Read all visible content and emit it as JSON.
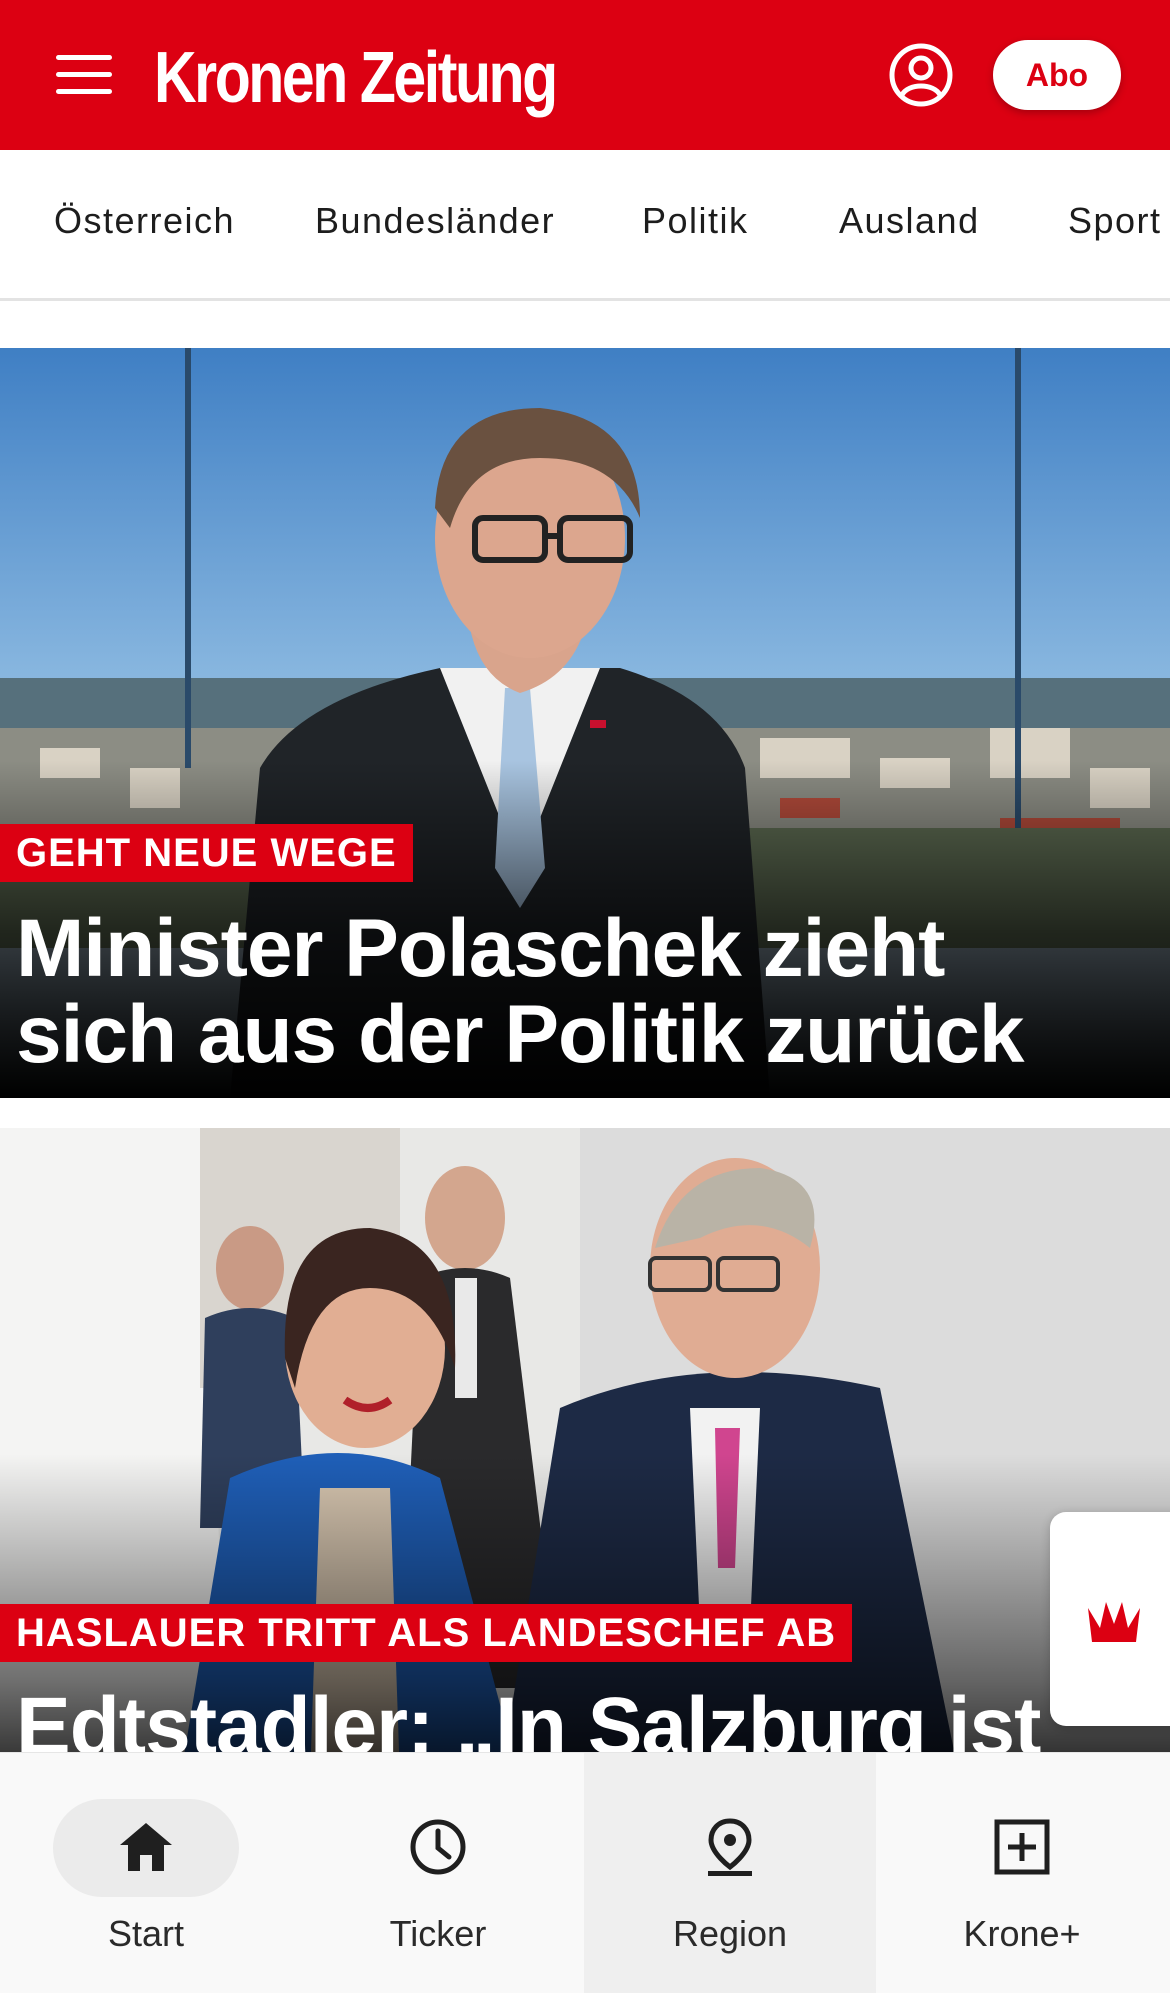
{
  "header": {
    "brand": "Kronen Zeitung",
    "abo_label": "Abo",
    "menu_icon": "hamburger-menu-icon",
    "account_icon": "account-icon",
    "brand_color": "#dc0012"
  },
  "categories": [
    "Österreich",
    "Bundesländer",
    "Politik",
    "Ausland",
    "Sport"
  ],
  "articles": [
    {
      "kicker": "GEHT NEUE WEGE",
      "headline_line1": "Minister Polaschek zieht",
      "headline_line2": "sich aus der Politik zurück"
    },
    {
      "kicker": "HASLAUER TRITT ALS LANDESCHEF AB",
      "headline_line1": "Edtstadler: „In Salzburg ist"
    }
  ],
  "crown_button": {
    "icon": "crown-icon"
  },
  "bottom_nav": [
    {
      "label": "Start",
      "icon": "home-icon"
    },
    {
      "label": "Ticker",
      "icon": "clock-icon"
    },
    {
      "label": "Region",
      "icon": "location-pin-icon"
    },
    {
      "label": "Krone+",
      "icon": "plus-square-icon"
    }
  ]
}
